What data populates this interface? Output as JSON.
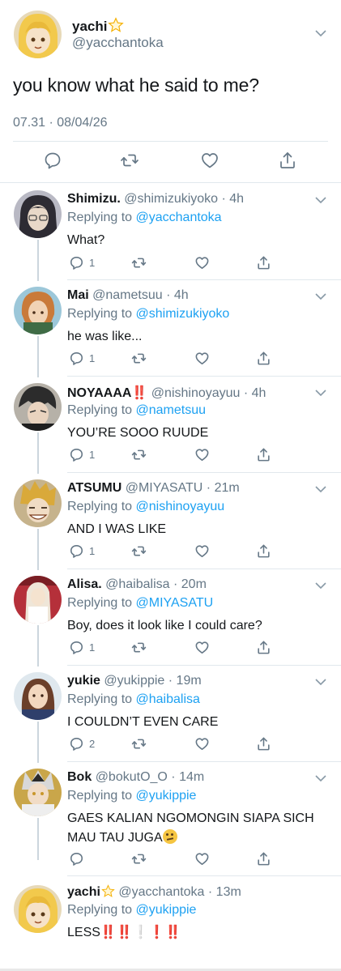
{
  "main_tweet": {
    "name": "yachi",
    "name_emoji": "star",
    "handle": "@yacchantoka",
    "text": "you know what he said to me?",
    "timestamp": "07.31 · 08/04/26"
  },
  "replies": [
    {
      "name": "Shimizu.",
      "handle": "@shimizukiyoko",
      "time": "4h",
      "replying_label": "Replying to",
      "replying_to": "@yacchantoka",
      "text": "What?",
      "reply_count": "1",
      "avatar_colors": [
        "#2d2b33",
        "#e8d8c8"
      ]
    },
    {
      "name": "Mai",
      "handle": "@nametsuu",
      "time": "4h",
      "replying_label": "Replying to",
      "replying_to": "@shimizukiyoko",
      "text": "he was like...",
      "reply_count": "1",
      "avatar_colors": [
        "#c97a3a",
        "#3f6b45"
      ]
    },
    {
      "name": "NOYAAAA",
      "name_suffix": "‼️",
      "handle": "@nishinoyayuu",
      "time": "4h",
      "replying_label": "Replying to",
      "replying_to": "@nametsuu",
      "text": "YOU’RE SOOO RUUDE",
      "reply_count": "1",
      "avatar_colors": [
        "#2c2c2c",
        "#e9d3bf"
      ]
    },
    {
      "name": "ATSUMU",
      "handle": "@MIYASATU",
      "time": "21m",
      "replying_label": "Replying to",
      "replying_to": "@nishinoyayuu",
      "text": "AND I WAS LIKE",
      "reply_count": "1",
      "avatar_colors": [
        "#d9a93a",
        "#f0dcc4"
      ]
    },
    {
      "name": "Alisa.",
      "handle": "@haibalisa",
      "time": "20m",
      "replying_label": "Replying to",
      "replying_to": "@MIYASATU",
      "text": "Boy, does it look like I could care?",
      "reply_count": "1",
      "avatar_colors": [
        "#b5303a",
        "#efe6d8"
      ]
    },
    {
      "name": "yukie",
      "handle": "@yukippie",
      "time": "19m",
      "replying_label": "Replying to",
      "replying_to": "@haibalisa",
      "text": "I COULDN’T EVEN CARE",
      "reply_count": "2",
      "avatar_colors": [
        "#6b3f2a",
        "#f3d7bf"
      ]
    },
    {
      "name": "Bok",
      "handle": "@bokutO_O",
      "time": "14m",
      "replying_label": "Replying to",
      "replying_to": "@yukippie",
      "text": "GAES KALIAN NGOMONGIN SIAPA SICH MAU TAU JUGA",
      "text_emoji": "thinking-face",
      "reply_count": "",
      "avatar_colors": [
        "#d8d8d8",
        "#2a2a2a"
      ]
    },
    {
      "name": "yachi",
      "name_emoji": "star",
      "handle": "@yacchantoka",
      "time": "13m",
      "replying_label": "Replying to",
      "replying_to": "@yukippie",
      "text": "LESS",
      "text_suffix": "‼️‼️❕❗‼️",
      "reply_count": "",
      "avatar_colors": [
        "#f2c94c",
        "#f6e2c8"
      ]
    }
  ],
  "colors": {
    "link": "#1da1f2",
    "secondary_text": "#657786",
    "divider": "#e1e8ed",
    "thread_line": "#ccd6dd"
  }
}
